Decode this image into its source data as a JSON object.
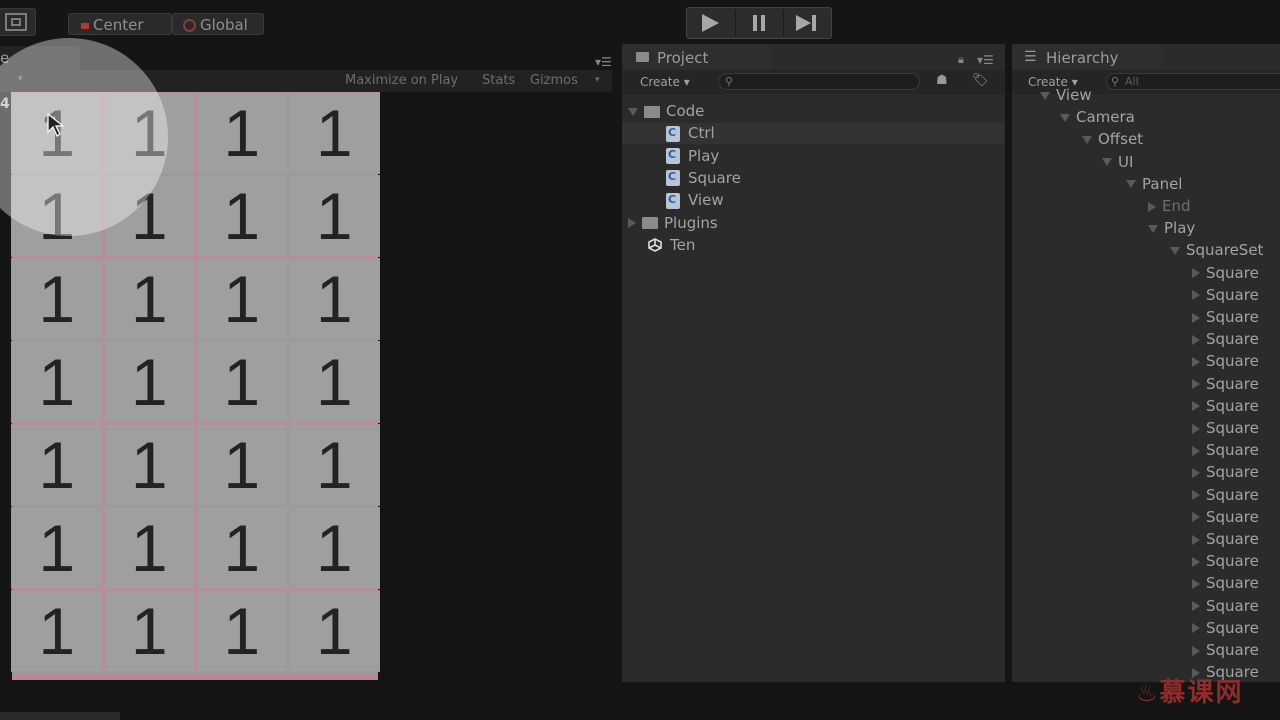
{
  "toolbar": {
    "pivot_label": "Center",
    "space_label": "Global",
    "play_icon": "play-icon",
    "pause_icon": "pause-icon",
    "step_icon": "step-icon"
  },
  "game": {
    "tab_label": "e",
    "resolution_fragment": "4",
    "maximize_label": "Maximize on Play",
    "stats_label": "Stats",
    "gizmos_label": "Gizmos",
    "grid": [
      [
        "1",
        "1",
        "1",
        "1"
      ],
      [
        "1",
        "1",
        "1",
        "1"
      ],
      [
        "1",
        "1",
        "1",
        "1"
      ],
      [
        "1",
        "1",
        "1",
        "1"
      ],
      [
        "1",
        "1",
        "1",
        "1"
      ],
      [
        "1",
        "1",
        "1",
        "1"
      ],
      [
        "1",
        "1",
        "1",
        "1"
      ]
    ]
  },
  "project": {
    "tab_label": "Project",
    "create_label": "Create",
    "items": [
      {
        "label": "Code",
        "type": "folder",
        "expanded": true
      },
      {
        "label": "Ctrl",
        "type": "script"
      },
      {
        "label": "Play",
        "type": "script"
      },
      {
        "label": "Square",
        "type": "script"
      },
      {
        "label": "View",
        "type": "script"
      },
      {
        "label": "Plugins",
        "type": "folder",
        "expanded": false
      },
      {
        "label": "Ten",
        "type": "scene"
      }
    ]
  },
  "hierarchy": {
    "tab_label": "Hierarchy",
    "create_label": "Create",
    "search_placeholder": "All",
    "items": [
      {
        "label": "View",
        "expanded": true
      },
      {
        "label": "Camera",
        "expanded": true
      },
      {
        "label": "Offset",
        "expanded": true
      },
      {
        "label": "UI",
        "expanded": true
      },
      {
        "label": "Panel",
        "expanded": true
      },
      {
        "label": "End",
        "expanded": false
      },
      {
        "label": "Play",
        "expanded": true
      },
      {
        "label": "SquareSet",
        "expanded": true
      },
      {
        "label": "Square",
        "expanded": false
      },
      {
        "label": "Square",
        "expanded": false
      },
      {
        "label": "Square",
        "expanded": false
      },
      {
        "label": "Square",
        "expanded": false
      },
      {
        "label": "Square",
        "expanded": false
      },
      {
        "label": "Square",
        "expanded": false
      },
      {
        "label": "Square",
        "expanded": false
      },
      {
        "label": "Square",
        "expanded": false
      },
      {
        "label": "Square",
        "expanded": false
      },
      {
        "label": "Square",
        "expanded": false
      },
      {
        "label": "Square",
        "expanded": false
      },
      {
        "label": "Square",
        "expanded": false
      },
      {
        "label": "Square",
        "expanded": false
      },
      {
        "label": "Square",
        "expanded": false
      },
      {
        "label": "Square",
        "expanded": false
      },
      {
        "label": "Square",
        "expanded": false
      },
      {
        "label": "Square",
        "expanded": false
      },
      {
        "label": "Square",
        "expanded": false
      },
      {
        "label": "Square",
        "expanded": false
      }
    ]
  },
  "watermark": "慕课网",
  "colors": {
    "board_cell": "#9f9f9f",
    "cell_border": "#b58d99",
    "panel_bg": "#2b2b2b"
  }
}
